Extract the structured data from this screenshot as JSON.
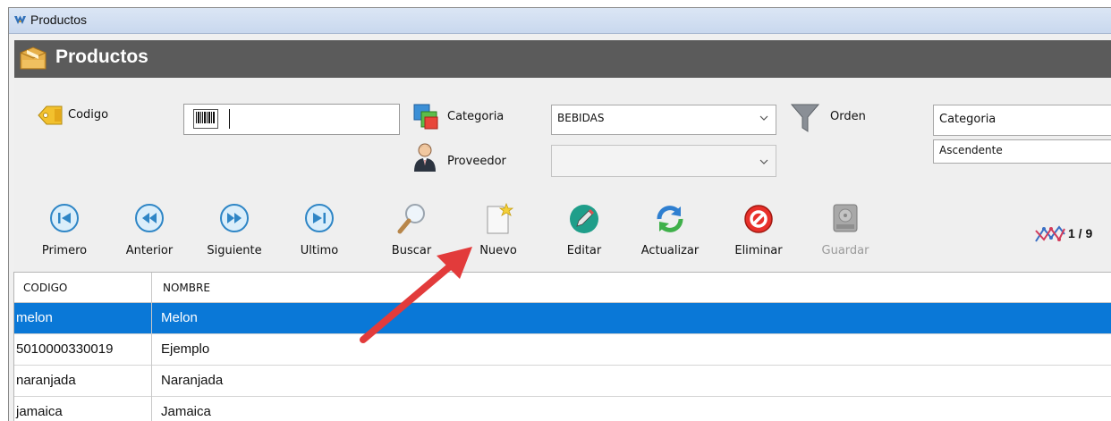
{
  "window": {
    "title": "Productos"
  },
  "header": {
    "title": "Productos"
  },
  "form": {
    "codigo_label": "Codigo",
    "codigo_value": "",
    "categoria_label": "Categoria",
    "categoria_value": "BEBIDAS",
    "proveedor_label": "Proveedor",
    "proveedor_value": "",
    "orden_label": "Orden",
    "orden_field_value": "Categoria",
    "orden_dir_value": "Ascendente"
  },
  "toolbar": {
    "primero": "Primero",
    "anterior": "Anterior",
    "siguiente": "Siguiente",
    "ultimo": "Ultimo",
    "buscar": "Buscar",
    "nuevo": "Nuevo",
    "editar": "Editar",
    "actualizar": "Actualizar",
    "eliminar": "Eliminar",
    "guardar": "Guardar"
  },
  "pager": {
    "text": "1 / 9"
  },
  "table": {
    "headers": [
      "CODIGO",
      "NOMBRE"
    ],
    "rows": [
      [
        "melon",
        "Melon"
      ],
      [
        "5010000330019",
        "Ejemplo"
      ],
      [
        "naranjada",
        "Naranjada"
      ],
      [
        "jamaica",
        "Jamaica"
      ]
    ],
    "selected_row": 0
  },
  "colors": {
    "header_bg": "#5b5b5b",
    "selection": "#0a78d7",
    "annotation_arrow": "#e03c3c",
    "nav_button": "#2f86c6"
  },
  "icons": {
    "window": "app-logo-icon",
    "header": "box-icon",
    "codigo": "tag-icon",
    "barcode": "barcode-icon",
    "categoria": "categories-icon",
    "proveedor": "person-icon",
    "orden": "filter-funnel-icon",
    "primero": "first-record-icon",
    "anterior": "previous-record-icon",
    "siguiente": "next-record-icon",
    "ultimo": "last-record-icon",
    "buscar": "magnifier-icon",
    "nuevo": "new-document-icon",
    "editar": "pencil-icon",
    "actualizar": "refresh-icon",
    "eliminar": "delete-icon",
    "guardar": "save-disk-icon",
    "pager": "chart-trend-icon"
  }
}
